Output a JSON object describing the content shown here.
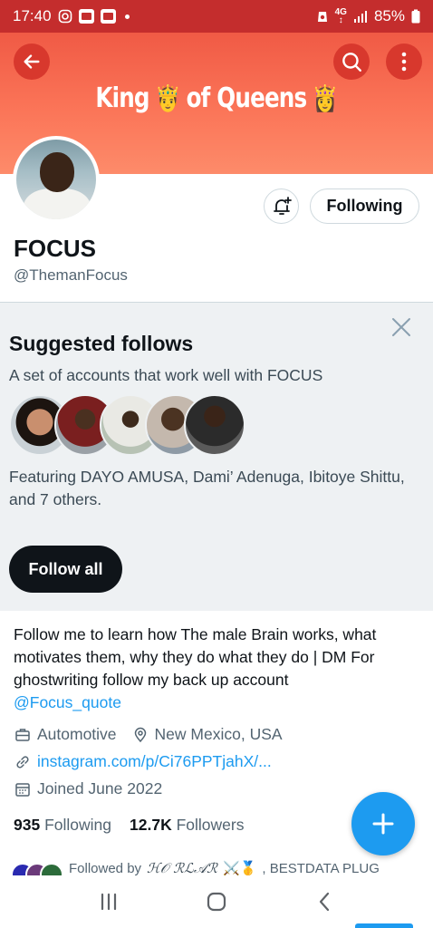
{
  "status_bar": {
    "time": "17:40",
    "network": "4G",
    "battery": "85%"
  },
  "header": {
    "banner_text_1": "King",
    "banner_text_2": "of Queens",
    "emoji_1": "🤴",
    "emoji_2": "👸",
    "accent_color": "#f05a45"
  },
  "profile": {
    "name": "FOCUS",
    "handle": "@ThemanFocus",
    "following_button": "Following"
  },
  "suggested": {
    "title": "Suggested follows",
    "subtitle": "A set of accounts that work well with FOCUS",
    "featuring": "Featuring DAYO AMUSA, Dami’ Adenuga, Ibitoye Shittu, and 7 others.",
    "follow_all": "Follow all"
  },
  "bio": {
    "text": "Follow me to learn how The male Brain works, what motivates them, why they do what they do | DM For ghostwriting follow my back up account ",
    "mention": "@Focus_quote"
  },
  "meta": {
    "category": "Automotive",
    "location": "New Mexico, USA",
    "link": "instagram.com/p/Ci76PPTjahX/...",
    "joined": "Joined June 2022"
  },
  "stats": {
    "following_count": "935",
    "following_label": "Following",
    "followers_count": "12.7K",
    "followers_label": "Followers"
  },
  "followed_by": {
    "prefix": "Followed by",
    "name_1": "ℋ𝒪 ℛℒ𝒜ℛ",
    "emoji": "⚔️🥇",
    "name_2": ", BESTDATA PLUG"
  },
  "icons": {
    "back": "arrow-left-icon",
    "search": "search-icon",
    "more": "more-vertical-icon",
    "notify": "bell-plus-icon",
    "compose": "plus-icon"
  }
}
